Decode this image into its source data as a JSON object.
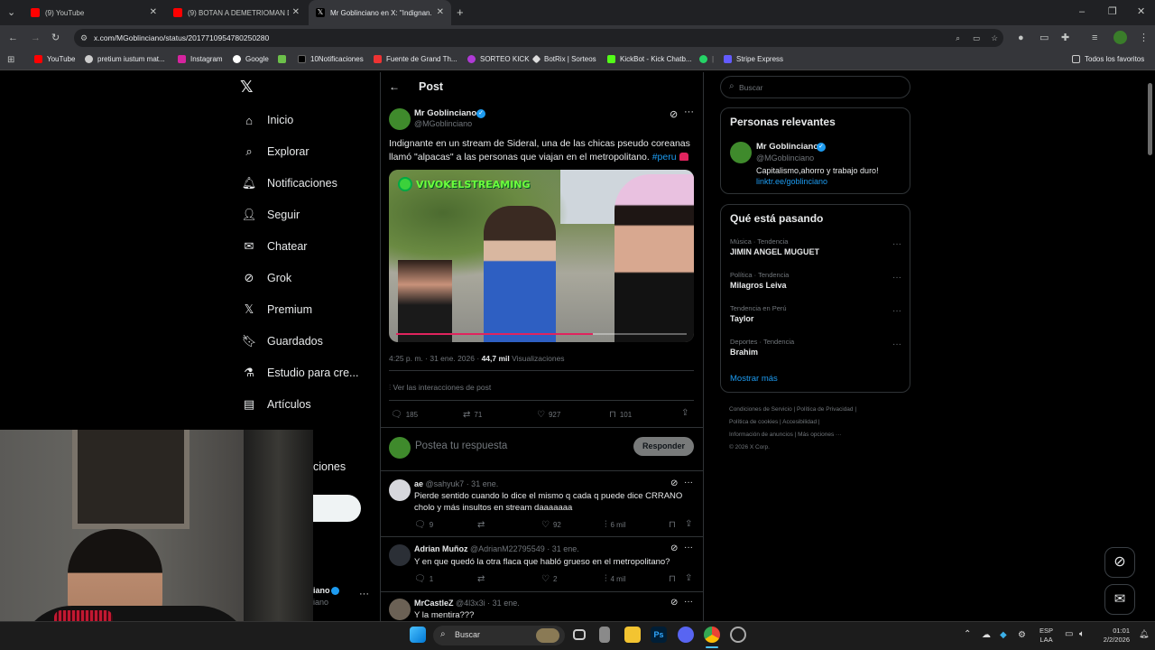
{
  "browser": {
    "tabs": [
      {
        "title": "(9) YouTube"
      },
      {
        "title": "(9) BOTAN A DEMETRIOMAN D..."
      },
      {
        "title": "Mr Goblinciano en X: \"Indignan..."
      }
    ],
    "url": "x.com/MGoblinciano/status/2017710954780250280",
    "bookmarks": [
      "YouTube",
      "pretium iustum mat...",
      "Instagram",
      "Google",
      "10Notificaciones",
      "Fuente de Grand Th...",
      "SORTEO KICK",
      "BotRix | Sorteos",
      "KickBot - Kick Chatb...",
      "Stripe Express"
    ],
    "bookmarks_all": "Todos los favoritos"
  },
  "nav": {
    "items": [
      "Inicio",
      "Explorar",
      "Notificaciones",
      "Seguir",
      "Chatear",
      "Grok",
      "Premium",
      "Guardados",
      "Estudio para cre...",
      "Artículos"
    ],
    "partial_item": "ciones",
    "account_name": "iano",
    "account_handle": "iano"
  },
  "header": {
    "title": "Post"
  },
  "post": {
    "author": "Mr Goblinciano",
    "handle": "@MGoblinciano",
    "text": "Indignante en un stream de Sideral, una de las chicas pseudo coreanas llamó \"alpacas\" a las personas que viajan en el metropolitano.",
    "hashtag": "#peru",
    "media_watermark": "VIVOKELSTREAMING",
    "time": "4:25 p. m. · 31 ene. 2026 ·",
    "views_count": "44,7 mil",
    "views_label": "Visualizaciones",
    "interactions": "Ver las interacciones de post",
    "replies": "185",
    "reposts": "71",
    "likes": "927",
    "bookmarks": "101"
  },
  "reply_box": {
    "placeholder": "Postea tu respuesta",
    "button": "Responder"
  },
  "replies": [
    {
      "name": "ae",
      "handle": "@sahyuk7 · 31 ene.",
      "text": "Pierde sentido cuando lo dice el mismo q cada q puede dice CRRANO cholo y más insultos en stream daaaaaaa",
      "replies": "9",
      "reposts": "",
      "likes": "92",
      "views": "6 mil"
    },
    {
      "name": "Adrian Muñoz",
      "handle": "@AdrianM22795549 · 31 ene.",
      "text": "Y en que quedó la otra flaca que habló grueso en el metropolitano?",
      "replies": "1",
      "reposts": "",
      "likes": "2",
      "views": "4 mil"
    },
    {
      "name": "MrCastleZ",
      "handle": "@4l3x3i · 31 ene.",
      "text": "Y la mentira???"
    }
  ],
  "search": {
    "placeholder": "Buscar"
  },
  "relevant": {
    "title": "Personas relevantes",
    "name": "Mr Goblinciano",
    "handle": "@MGoblinciano",
    "bio": "Capitalismo,ahorro y trabajo duro!",
    "link": "linktr.ee/goblinciano"
  },
  "trends": {
    "title": "Qué está pasando",
    "items": [
      {
        "category": "Música · Tendencia",
        "name": "JIMIN ANGEL MUGUET"
      },
      {
        "category": "Política · Tendencia",
        "name": "Milagros Leiva"
      },
      {
        "category": "Tendencia en Perú",
        "name": "Taylor"
      },
      {
        "category": "Deportes · Tendencia",
        "name": "Brahim"
      }
    ],
    "more": "Mostrar más"
  },
  "footer": {
    "line1": "Condiciones de Servicio  |  Política de Privacidad  |",
    "line2": "Política de cookies  |  Accesibilidad  |",
    "line3": "Información de anuncios  |  Más opciones ···",
    "line4": "© 2026 X Corp."
  },
  "taskbar": {
    "search": "Buscar",
    "lang1": "ESP",
    "lang2": "LAA",
    "time": "01:01",
    "date": "2/2/2026"
  },
  "colors": {
    "accent": "#1d9bf0",
    "bg": "#000000",
    "border": "#2f3336"
  }
}
